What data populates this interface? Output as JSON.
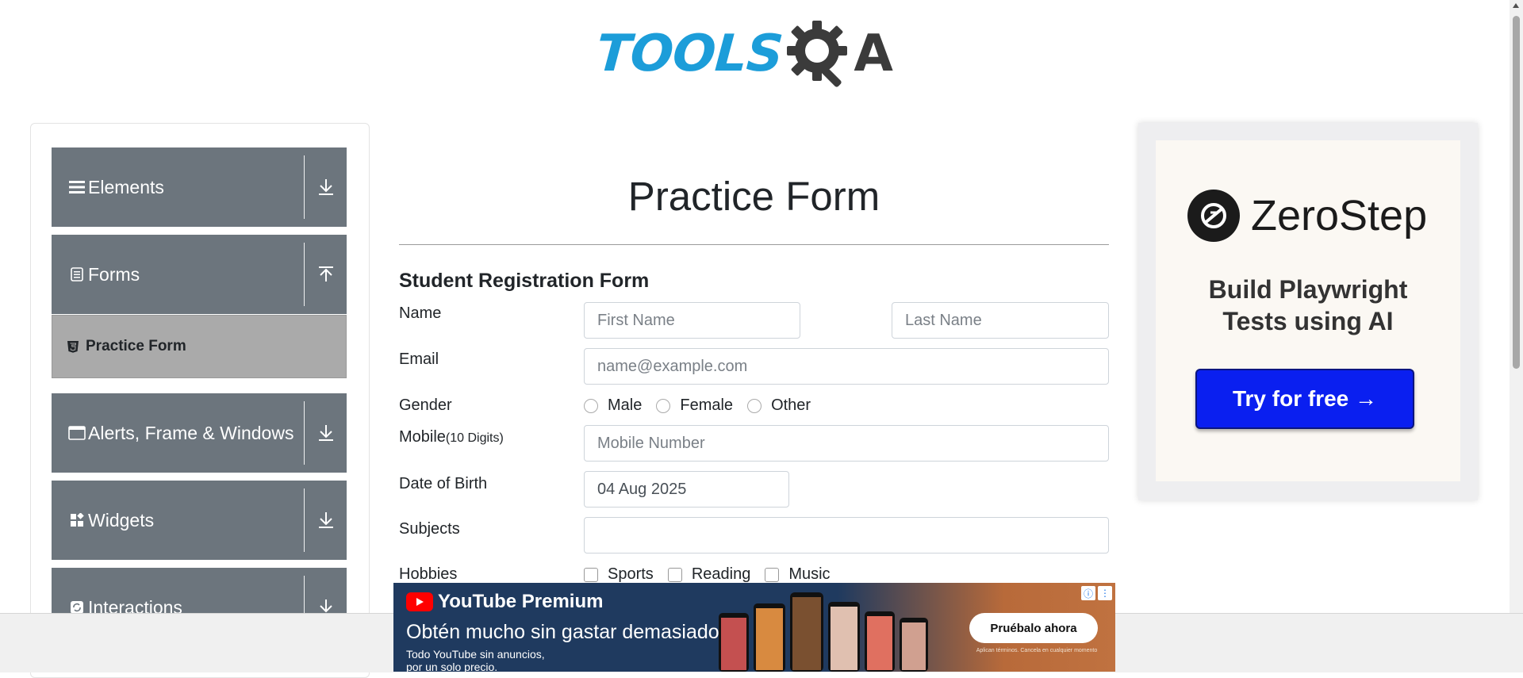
{
  "logo": {
    "text_left": "TOOLS",
    "text_right": "A",
    "alt": "TOOLSQA"
  },
  "sidebar": {
    "groups": [
      {
        "label": "Elements",
        "icon": "hamburger-icon",
        "toggle": "expand-arrow-icon"
      },
      {
        "label": "Forms",
        "icon": "document-icon",
        "toggle": "collapse-arrow-icon"
      },
      {
        "label": "Alerts, Frame & Windows",
        "icon": "window-icon",
        "toggle": "expand-arrow-icon"
      },
      {
        "label": "Widgets",
        "icon": "widgets-icon",
        "toggle": "expand-arrow-icon"
      },
      {
        "label": "Interactions",
        "icon": "refresh-icon",
        "toggle": "expand-arrow-icon"
      }
    ],
    "active_item": {
      "label": "Practice Form",
      "icon": "html5-icon"
    }
  },
  "main": {
    "title": "Practice Form",
    "form_title": "Student Registration Form",
    "labels": {
      "name": "Name",
      "email": "Email",
      "gender": "Gender",
      "mobile": "Mobile",
      "mobile_hint": "(10 Digits)",
      "dob": "Date of Birth",
      "subjects": "Subjects",
      "hobbies": "Hobbies"
    },
    "placeholders": {
      "first_name": "First Name",
      "last_name": "Last Name",
      "email": "name@example.com",
      "mobile": "Mobile Number"
    },
    "values": {
      "dob": "04 Aug 2025",
      "subjects": ""
    },
    "gender_options": [
      "Male",
      "Female",
      "Other"
    ],
    "hobby_options": [
      "Sports",
      "Reading",
      "Music"
    ]
  },
  "ad_right": {
    "brand": "ZeroStep",
    "tagline_line1": "Build Playwright",
    "tagline_line2": "Tests using AI",
    "cta": "Try for free →"
  },
  "ad_bottom": {
    "brand": "YouTube Premium",
    "headline": "Obtén mucho sin gastar demasiado.",
    "sub_line1": "Todo YouTube sin anuncios,",
    "sub_line2": "por un solo precio.",
    "cta": "Pruébalo ahora",
    "terms": "Aplican términos. Cancela en cualquier momento"
  },
  "colors": {
    "sidebar_group": "#6c757d",
    "active_item": "#aaaaaa",
    "logo_blue": "#1c9dd9",
    "cta_blue": "#0a1ff0"
  }
}
